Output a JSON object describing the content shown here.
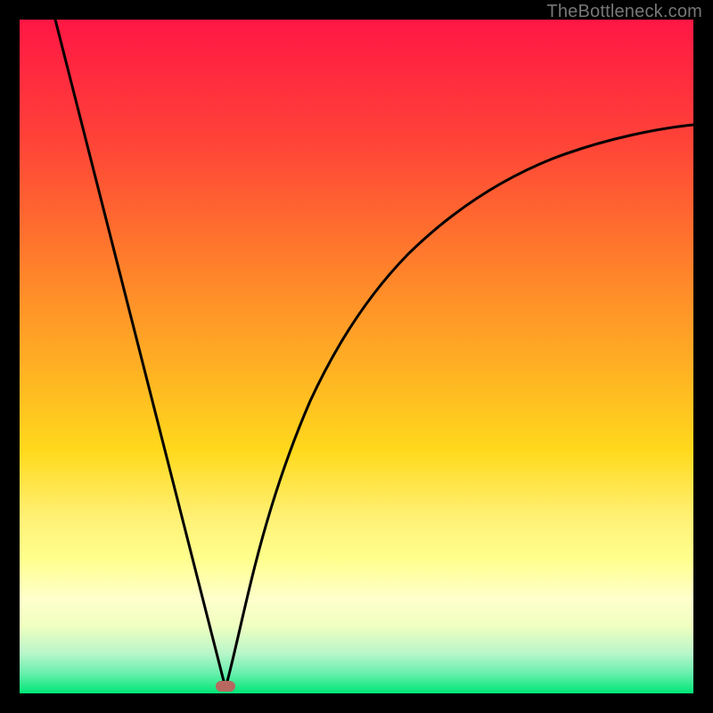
{
  "watermark": "TheBottleneck.com",
  "marker": {
    "cx": 253,
    "cy": 770,
    "color": "#b8685f"
  },
  "chart_data": {
    "type": "line",
    "title": "",
    "xlabel": "",
    "ylabel": "",
    "xlim": [
      22,
      778
    ],
    "ylim": [
      22,
      778
    ],
    "series": [
      {
        "name": "left-branch",
        "x": [
          62,
          80,
          100,
          120,
          140,
          160,
          180,
          200,
          220,
          240,
          253
        ],
        "y": [
          22,
          90,
          170,
          250,
          330,
          410,
          490,
          575,
          660,
          740,
          772
        ]
      },
      {
        "name": "right-branch",
        "x": [
          253,
          260,
          270,
          282,
          296,
          314,
          336,
          362,
          394,
          432,
          478,
          530,
          590,
          660,
          740,
          778
        ],
        "y": [
          772,
          745,
          700,
          650,
          595,
          535,
          475,
          418,
          362,
          312,
          268,
          230,
          198,
          170,
          148,
          140
        ]
      }
    ],
    "gradient_stops": [
      {
        "pos": 0.0,
        "color": "#ff1744"
      },
      {
        "pos": 0.5,
        "color": "#ffc107"
      },
      {
        "pos": 0.85,
        "color": "#ffffcc"
      },
      {
        "pos": 1.0,
        "color": "#00e676"
      }
    ]
  }
}
